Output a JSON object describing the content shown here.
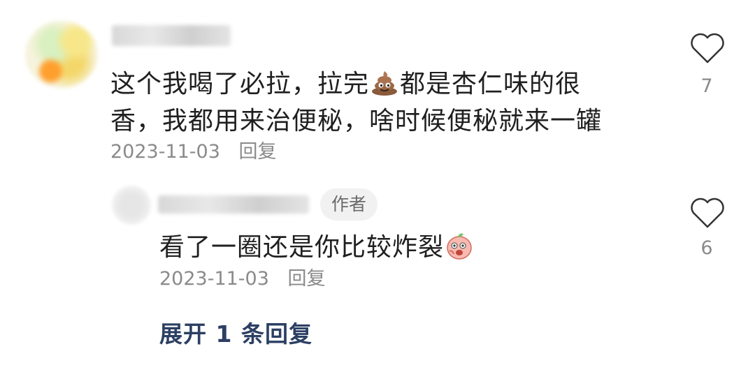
{
  "comments": [
    {
      "text_line1": "这个我喝了必拉，拉完",
      "text_line1b": "都是杏仁味的很",
      "text_line2": "香，我都用来治便秘，啥时候便秘就来一罐",
      "date": "2023-11-03",
      "reply_label": "回复",
      "like_count": "7",
      "emoji": "poop-emoji"
    },
    {
      "author_badge": "作者",
      "text": "看了一圈还是你比较炸裂",
      "date": "2023-11-03",
      "reply_label": "回复",
      "like_count": "6",
      "emoji": "peach-face-emoji"
    }
  ],
  "expand_replies": "展开 1 条回复",
  "colors": {
    "text": "#1f1f1f",
    "meta": "#8a8a8a",
    "link": "#2c3f63",
    "badge_bg": "#f1f1f1"
  }
}
